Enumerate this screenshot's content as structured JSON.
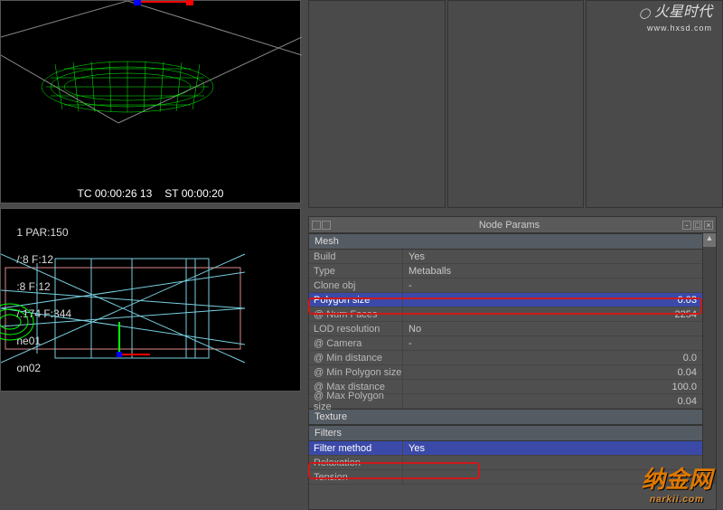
{
  "timecode": {
    "tc": "TC 00:00:26 13",
    "st": "ST 00:00:20"
  },
  "viewport_info": {
    "line1": "1 PAR:150",
    "line2": "/:8 F:12",
    "line3": ":8 F:12",
    "line4": "/:174 F:344",
    "line5": "ne01",
    "line6": "on02"
  },
  "node_params": {
    "title": "Node Params",
    "sections": {
      "mesh": "Mesh",
      "texture": "Texture",
      "filters": "Filters"
    },
    "rows": {
      "build": {
        "label": "Build",
        "value": "Yes"
      },
      "type": {
        "label": "Type",
        "value": "Metaballs"
      },
      "clone_obj": {
        "label": "Clone obj",
        "value": "-"
      },
      "polygon_size": {
        "label": "Polygon size",
        "value": "0.03"
      },
      "num_faces": {
        "label": "@ Num Faces",
        "value": "2254"
      },
      "lod_resolution": {
        "label": "LOD resolution",
        "value": "No"
      },
      "camera": {
        "label": "@ Camera",
        "value": "-"
      },
      "min_distance": {
        "label": "@ Min distance",
        "value": "0.0"
      },
      "min_polygon_size": {
        "label": "@ Min Polygon size",
        "value": "0.04"
      },
      "max_distance": {
        "label": "@ Max distance",
        "value": "100.0"
      },
      "max_polygon_size": {
        "label": "@ Max Polygon size",
        "value": "0.04"
      },
      "filter_method": {
        "label": "Filter method",
        "value": "Yes"
      },
      "relaxation": {
        "label": "Relaxation",
        "value": ""
      },
      "tension": {
        "label": "Tension",
        "value": ""
      }
    }
  },
  "watermarks": {
    "top_cn": "火星时代",
    "top_url": "www.hxsd.com",
    "bot_cn": "纳金网",
    "bot_url": "narkii.com"
  }
}
